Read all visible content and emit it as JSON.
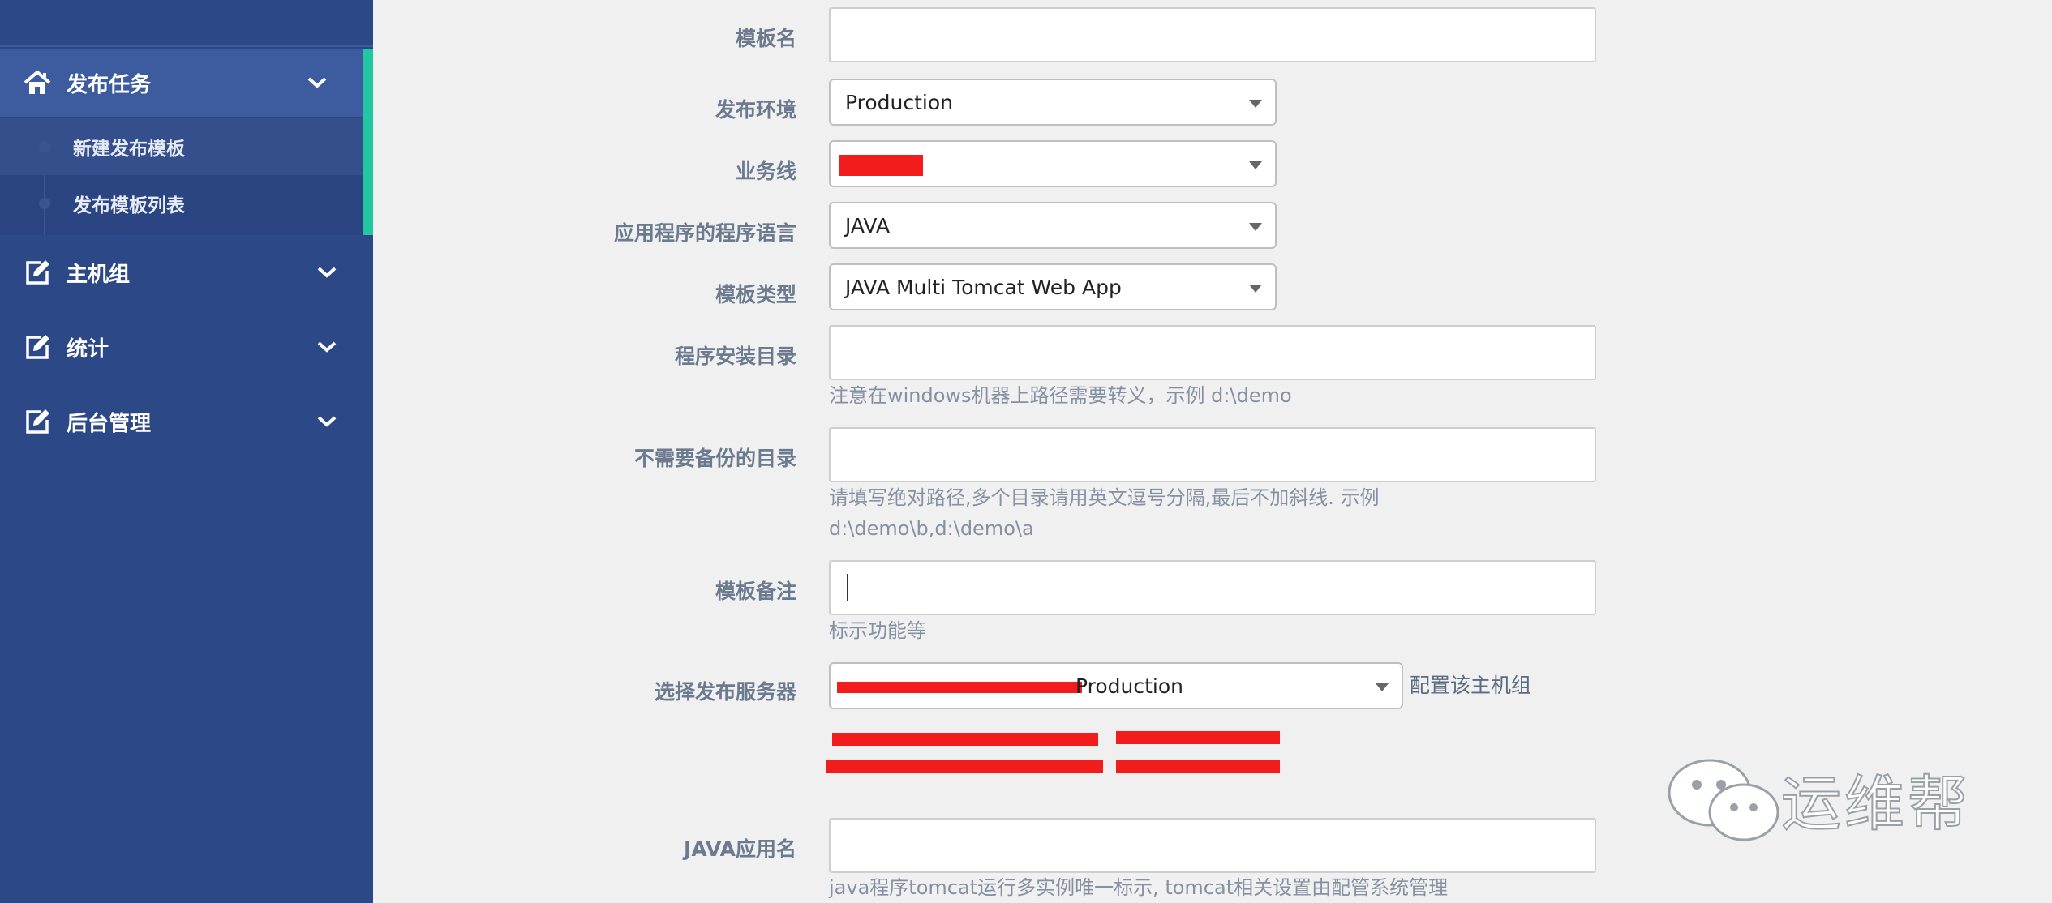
{
  "sidebar": {
    "items": [
      {
        "label": "发布任务",
        "icon": "home-icon",
        "expanded": true
      },
      {
        "label": "主机组",
        "icon": "edit-icon"
      },
      {
        "label": "统计",
        "icon": "edit-icon"
      },
      {
        "label": "后台管理",
        "icon": "edit-icon"
      }
    ],
    "submenu": [
      {
        "label": "新建发布模板",
        "active": true
      },
      {
        "label": "发布模板列表"
      }
    ]
  },
  "form": {
    "template_name": {
      "label": "模板名",
      "value": ""
    },
    "environment": {
      "label": "发布环境",
      "value": "Production"
    },
    "business_line": {
      "label": "业务线",
      "value": ""
    },
    "language": {
      "label": "应用程序的程序语言",
      "value": "JAVA"
    },
    "template_type": {
      "label": "模板类型",
      "value": "JAVA Multi Tomcat Web App"
    },
    "install_dir": {
      "label": "程序安装目录",
      "value": "",
      "help": "注意在windows机器上路径需要转义，示例 d:\\demo"
    },
    "no_backup_dir": {
      "label": "不需要备份的目录",
      "value": "",
      "help_line1": "请填写绝对路径,多个目录请用英文逗号分隔,最后不加斜线. 示例",
      "help_line2": "d:\\demo\\b,d:\\demo\\a"
    },
    "remark": {
      "label": "模板备注",
      "value": "",
      "help": "标示功能等"
    },
    "server": {
      "label": "选择发布服务器",
      "value": "Production",
      "link": "配置该主机组"
    },
    "java_app_name": {
      "label": "JAVA应用名",
      "value": "",
      "help": "java程序tomcat运行多实例唯一标示, tomcat相关设置由配管系统管理"
    }
  },
  "watermark": {
    "text": "运维帮"
  },
  "colors": {
    "sidebar_bg": "#2c4887",
    "sidebar_active": "#3d5c9f",
    "accent": "#21c7a1",
    "label": "#6b7a8f",
    "help": "#8590a2"
  }
}
